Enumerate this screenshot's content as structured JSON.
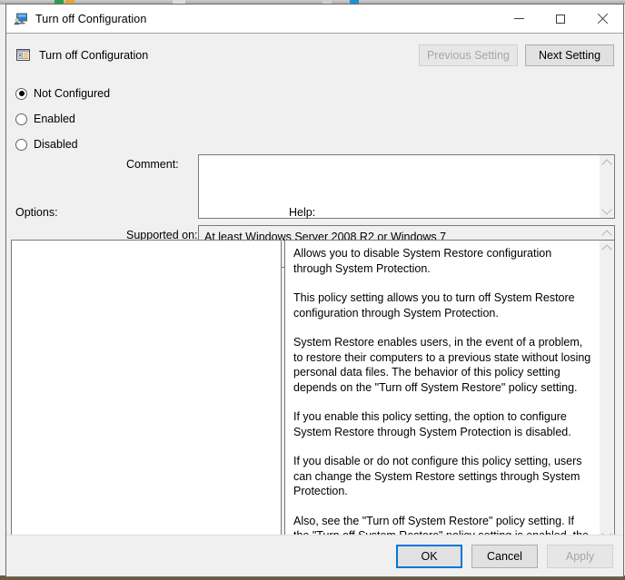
{
  "window": {
    "title": "Turn off Configuration",
    "titlebar_icon": "computer-user-monitor-icon",
    "controls": {
      "minimize": "minimize-icon",
      "maximize": "maximize-icon",
      "close": "close-icon"
    }
  },
  "header": {
    "policy_icon": "group-policy-setting-icon",
    "policy_name": "Turn off Configuration",
    "previous_setting_label": "Previous Setting",
    "previous_setting_enabled": false,
    "next_setting_label": "Next Setting",
    "next_setting_enabled": true
  },
  "state_options": {
    "selected": "Not Configured",
    "items": [
      {
        "label": "Not Configured",
        "checked": true
      },
      {
        "label": "Enabled",
        "checked": false
      },
      {
        "label": "Disabled",
        "checked": false
      }
    ]
  },
  "comment": {
    "label": "Comment:",
    "value": "",
    "scrollbar_up": "chevron-up-icon",
    "scrollbar_down": "chevron-down-icon"
  },
  "supported_on": {
    "label": "Supported on:",
    "value": "At least Windows Server 2008 R2 or Windows 7",
    "readonly": true,
    "scrollbar_up": "chevron-up-icon",
    "scrollbar_down": "chevron-down-icon"
  },
  "options": {
    "label": "Options:",
    "content": ""
  },
  "help": {
    "label": "Help:",
    "paragraphs": [
      "Allows you to disable System Restore configuration through System Protection.",
      "This policy setting allows you to turn off System Restore configuration through System Protection.",
      "System Restore enables users, in the event of a problem, to restore their computers to a previous state without losing personal data files. The behavior of this policy setting depends on the \"Turn off System Restore\" policy setting.",
      "If you enable this policy setting, the option to configure System Restore through System Protection is disabled.",
      "If you disable or do not configure this policy setting, users can change the System Restore settings through System Protection.",
      "Also, see the \"Turn off System Restore\" policy setting. If the \"Turn off System Restore\" policy setting is enabled, the \"Turn off System Restore configuration\" policy setting is overwritten."
    ],
    "scrollbar_up": "chevron-up-icon",
    "scrollbar_down": "chevron-down-icon"
  },
  "footer": {
    "ok_label": "OK",
    "ok_is_default": true,
    "cancel_label": "Cancel",
    "apply_label": "Apply",
    "apply_enabled": false
  },
  "colors": {
    "dialog_background": "#f0f0f0",
    "titlebar_background": "#ffffff",
    "field_background": "#ffffff",
    "readonly_field_background": "#f0f0f0",
    "border": "#7a7a7a",
    "button_face": "#e1e1e1",
    "button_border": "#adadad",
    "disabled_text": "#a6a6a6",
    "focus_accent": "#0078d7",
    "scroll_arrow": "#b4b4b4"
  }
}
